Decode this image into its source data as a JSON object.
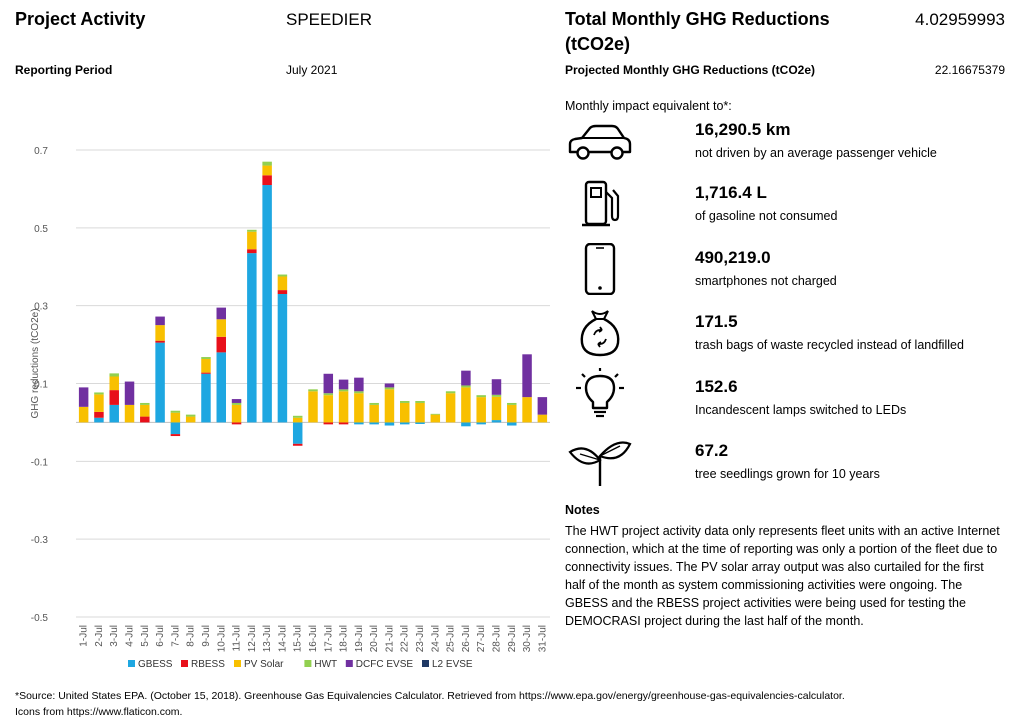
{
  "header": {
    "project_activity_label": "Project Activity",
    "project_activity_value": "SPEEDIER",
    "reporting_period_label": "Reporting Period",
    "reporting_period_value": "July 2021",
    "total_label_line1": "Total Monthly GHG Reductions",
    "total_label_line2": "(tCO2e)",
    "total_value": "4.02959993",
    "projected_label": "Projected Monthly GHG Reductions (tCO2e)",
    "projected_value": "22.16675379"
  },
  "impact": {
    "intro": "Monthly impact equivalent to*:",
    "items": [
      {
        "icon": "car-icon",
        "value": "16,290.5 km",
        "label": "not driven by an average passenger vehicle"
      },
      {
        "icon": "fuel-pump-icon",
        "value": "1,716.4 L",
        "label": "of gasoline not consumed"
      },
      {
        "icon": "smartphone-icon",
        "value": "490,219.0",
        "label": "smartphones not charged"
      },
      {
        "icon": "recycle-bag-icon",
        "value": "171.5",
        "label": "trash bags of waste recycled instead of landfilled"
      },
      {
        "icon": "light-bulb-icon",
        "value": "152.6",
        "label": "Incandescent lamps switched to LEDs"
      },
      {
        "icon": "seedling-icon",
        "value": "67.2",
        "label": "tree seedlings grown for 10 years"
      }
    ]
  },
  "notes": {
    "title": "Notes",
    "text": "The HWT project activity data only represents fleet units with an active Internet connection, which at the time of reporting was only a portion of the fleet due to connectivity issues. The PV solar array output was also curtailed for the first half of the month as system commissioning activities were ongoing. The GBESS and the RBESS project activities were being used for testing the DEMOCRASI project during the last half of the month."
  },
  "footer": {
    "source": "*Source: United States EPA. (October 15, 2018). Greenhouse Gas Equivalencies Calculator. Retrieved from https://www.epa.gov/energy/greenhouse-gas-equivalencies-calculator.",
    "icons": "Icons from https://www.flaticon.com."
  },
  "chart_data": {
    "type": "bar",
    "stacked": true,
    "ylabel": "GHG reductions (tCO2e)",
    "ylim": [
      -0.5,
      0.7
    ],
    "yticks": [
      0.7,
      0.5,
      0.3,
      0.1,
      -0.1,
      -0.3,
      -0.5
    ],
    "ytick_labels": [
      "0.7",
      "0.5",
      "0.3",
      "0.1",
      "-0.1",
      "-0.3",
      "-0.5"
    ],
    "grid": true,
    "legend_position": "bottom",
    "categories": [
      "1-Jul",
      "2-Jul",
      "3-Jul",
      "4-Jul",
      "5-Jul",
      "6-Jul",
      "7-Jul",
      "8-Jul",
      "9-Jul",
      "10-Jul",
      "11-Jul",
      "12-Jul",
      "13-Jul",
      "14-Jul",
      "15-Jul",
      "16-Jul",
      "17-Jul",
      "18-Jul",
      "19-Jul",
      "20-Jul",
      "21-Jul",
      "22-Jul",
      "23-Jul",
      "24-Jul",
      "25-Jul",
      "26-Jul",
      "27-Jul",
      "28-Jul",
      "29-Jul",
      "30-Jul",
      "31-Jul"
    ],
    "series": [
      {
        "name": "GBESS",
        "color": "#1EA7E1",
        "values": [
          0,
          0.012,
          0.045,
          0,
          0,
          0.205,
          -0.03,
          0,
          0.125,
          0.18,
          0,
          0.435,
          0.61,
          0.33,
          -0.055,
          0,
          0,
          0,
          -0.005,
          -0.005,
          -0.008,
          -0.005,
          -0.004,
          0,
          0,
          -0.01,
          -0.005,
          0.006,
          -0.008,
          0,
          0
        ]
      },
      {
        "name": "RBESS",
        "color": "#E8101A",
        "values": [
          0,
          0.015,
          0.038,
          0,
          0.015,
          0.005,
          -0.005,
          0,
          0.003,
          0.04,
          -0.005,
          0.01,
          0.025,
          0.01,
          -0.005,
          0,
          -0.005,
          -0.005,
          0,
          0,
          0,
          0,
          0,
          0,
          0,
          0,
          0,
          0,
          0,
          0,
          0
        ]
      },
      {
        "name": "PV Solar",
        "color": "#F8C000",
        "values": [
          0.04,
          0.045,
          0.035,
          0.045,
          0.03,
          0.04,
          0.025,
          0.015,
          0.035,
          0.045,
          0.045,
          0.045,
          0.025,
          0.035,
          0.012,
          0.08,
          0.07,
          0.08,
          0.075,
          0.045,
          0.085,
          0.05,
          0.05,
          0.02,
          0.075,
          0.09,
          0.065,
          0.06,
          0.045,
          0.065,
          0.02
        ]
      },
      {
        "name": "HWT",
        "color": "#92D050",
        "values": [
          0,
          0.005,
          0.008,
          0,
          0.005,
          0,
          0.005,
          0.005,
          0.005,
          0,
          0.005,
          0.005,
          0.01,
          0.005,
          0.005,
          0.005,
          0.005,
          0.005,
          0.005,
          0.005,
          0.005,
          0.005,
          0.005,
          0.002,
          0.005,
          0.005,
          0.005,
          0.005,
          0.005,
          0,
          0
        ]
      },
      {
        "name": "DCFC EVSE",
        "color": "#7030A0",
        "values": [
          0.05,
          0,
          0,
          0.06,
          0,
          0.022,
          0,
          0,
          0,
          0.03,
          0.01,
          0,
          0,
          0,
          0,
          0,
          0.05,
          0.025,
          0.035,
          0,
          0.01,
          0,
          0,
          0,
          0,
          0.038,
          0,
          0.04,
          0,
          0.11,
          0.045
        ]
      },
      {
        "name": "L2 EVSE",
        "color": "#1F3864",
        "values": [
          0,
          0,
          0,
          0,
          0,
          0,
          0,
          0,
          0,
          0,
          0,
          0,
          0,
          0,
          0,
          0,
          0,
          0,
          0,
          0,
          0,
          0,
          0,
          0,
          0,
          0,
          0,
          0,
          0,
          0,
          0
        ]
      }
    ]
  }
}
